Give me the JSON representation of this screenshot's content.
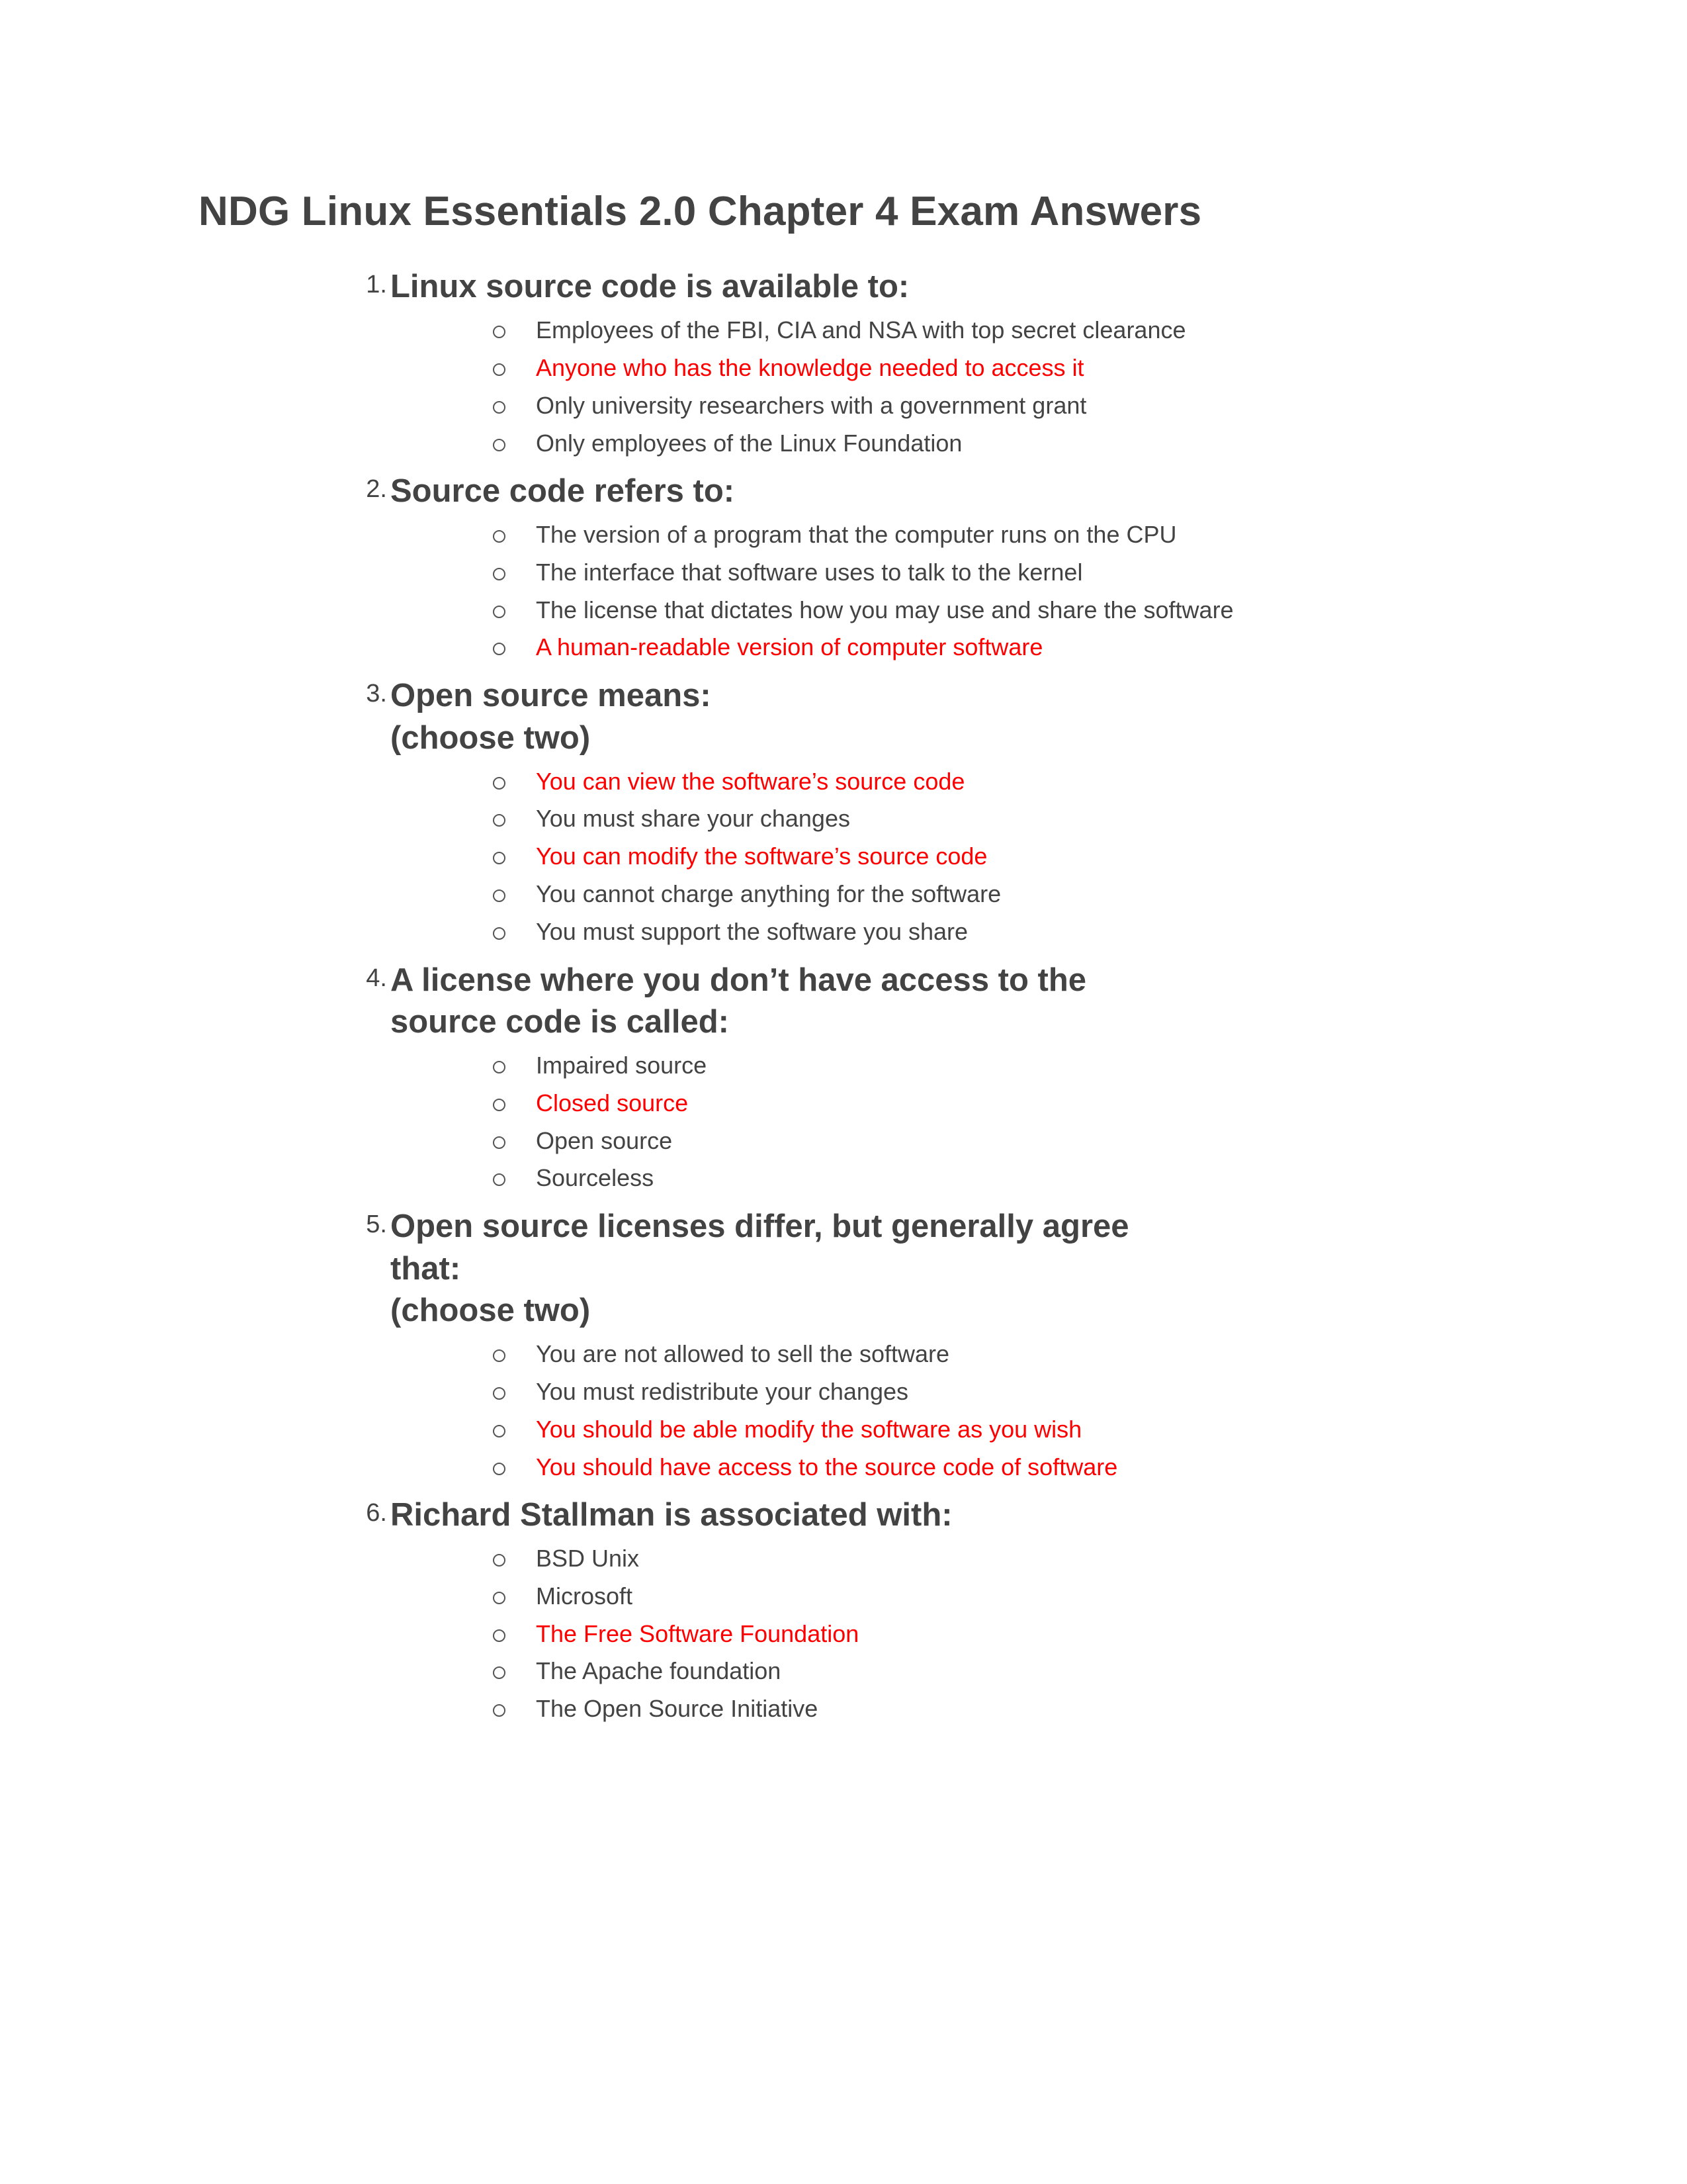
{
  "document": {
    "title": "NDG Linux Essentials 2.0 Chapter 4 Exam Answers",
    "text_color": "#434343",
    "correct_answer_color": "#ff0000",
    "background_color": "#ffffff"
  },
  "questions": [
    {
      "number": "1.",
      "lines": [
        "Linux source code is available to:"
      ],
      "options": [
        {
          "text": "Employees of the FBI, CIA and NSA with top secret clearance",
          "correct": false
        },
        {
          "text": "Anyone who has the knowledge needed to access it",
          "correct": true
        },
        {
          "text": "Only university researchers with a government grant",
          "correct": false
        },
        {
          "text": "Only employees of the Linux Foundation",
          "correct": false
        }
      ]
    },
    {
      "number": "2.",
      "lines": [
        "Source code refers to:"
      ],
      "options": [
        {
          "text": "The version of a program that the computer runs on the CPU",
          "correct": false
        },
        {
          "text": "The interface that software uses to talk to the kernel",
          "correct": false
        },
        {
          "text": "The license that dictates how you may use and share the software",
          "correct": false
        },
        {
          "text": "A human-readable version of computer software",
          "correct": true
        }
      ]
    },
    {
      "number": "3.",
      "lines": [
        "Open source means:",
        "(choose two)"
      ],
      "options": [
        {
          "text": "You can view the software’s source code",
          "correct": true
        },
        {
          "text": "You must share your changes",
          "correct": false
        },
        {
          "text": "You can modify the software’s source code",
          "correct": true
        },
        {
          "text": "You cannot charge anything for the software",
          "correct": false
        },
        {
          "text": "You must support the software you share",
          "correct": false
        }
      ]
    },
    {
      "number": "4.",
      "lines": [
        "A license where you don’t have access to the",
        "source code is called:"
      ],
      "options": [
        {
          "text": "Impaired source",
          "correct": false
        },
        {
          "text": "Closed source",
          "correct": true
        },
        {
          "text": "Open source",
          "correct": false
        },
        {
          "text": "Sourceless",
          "correct": false
        }
      ]
    },
    {
      "number": "5.",
      "lines": [
        "Open source licenses differ, but generally agree",
        "that:",
        "(choose two)"
      ],
      "options": [
        {
          "text": "You are not allowed to sell the software",
          "correct": false
        },
        {
          "text": "You must redistribute your changes",
          "correct": false
        },
        {
          "text": "You should be able modify the software as you wish",
          "correct": true
        },
        {
          "text": "You should have access to the source code of software",
          "correct": true
        }
      ]
    },
    {
      "number": "6.",
      "lines": [
        "Richard Stallman is associated with:"
      ],
      "options": [
        {
          "text": "BSD Unix",
          "correct": false
        },
        {
          "text": "Microsoft",
          "correct": false
        },
        {
          "text": "The Free Software Foundation",
          "correct": true
        },
        {
          "text": "The Apache foundation",
          "correct": false
        },
        {
          "text": "The Open Source Initiative",
          "correct": false
        }
      ]
    }
  ]
}
